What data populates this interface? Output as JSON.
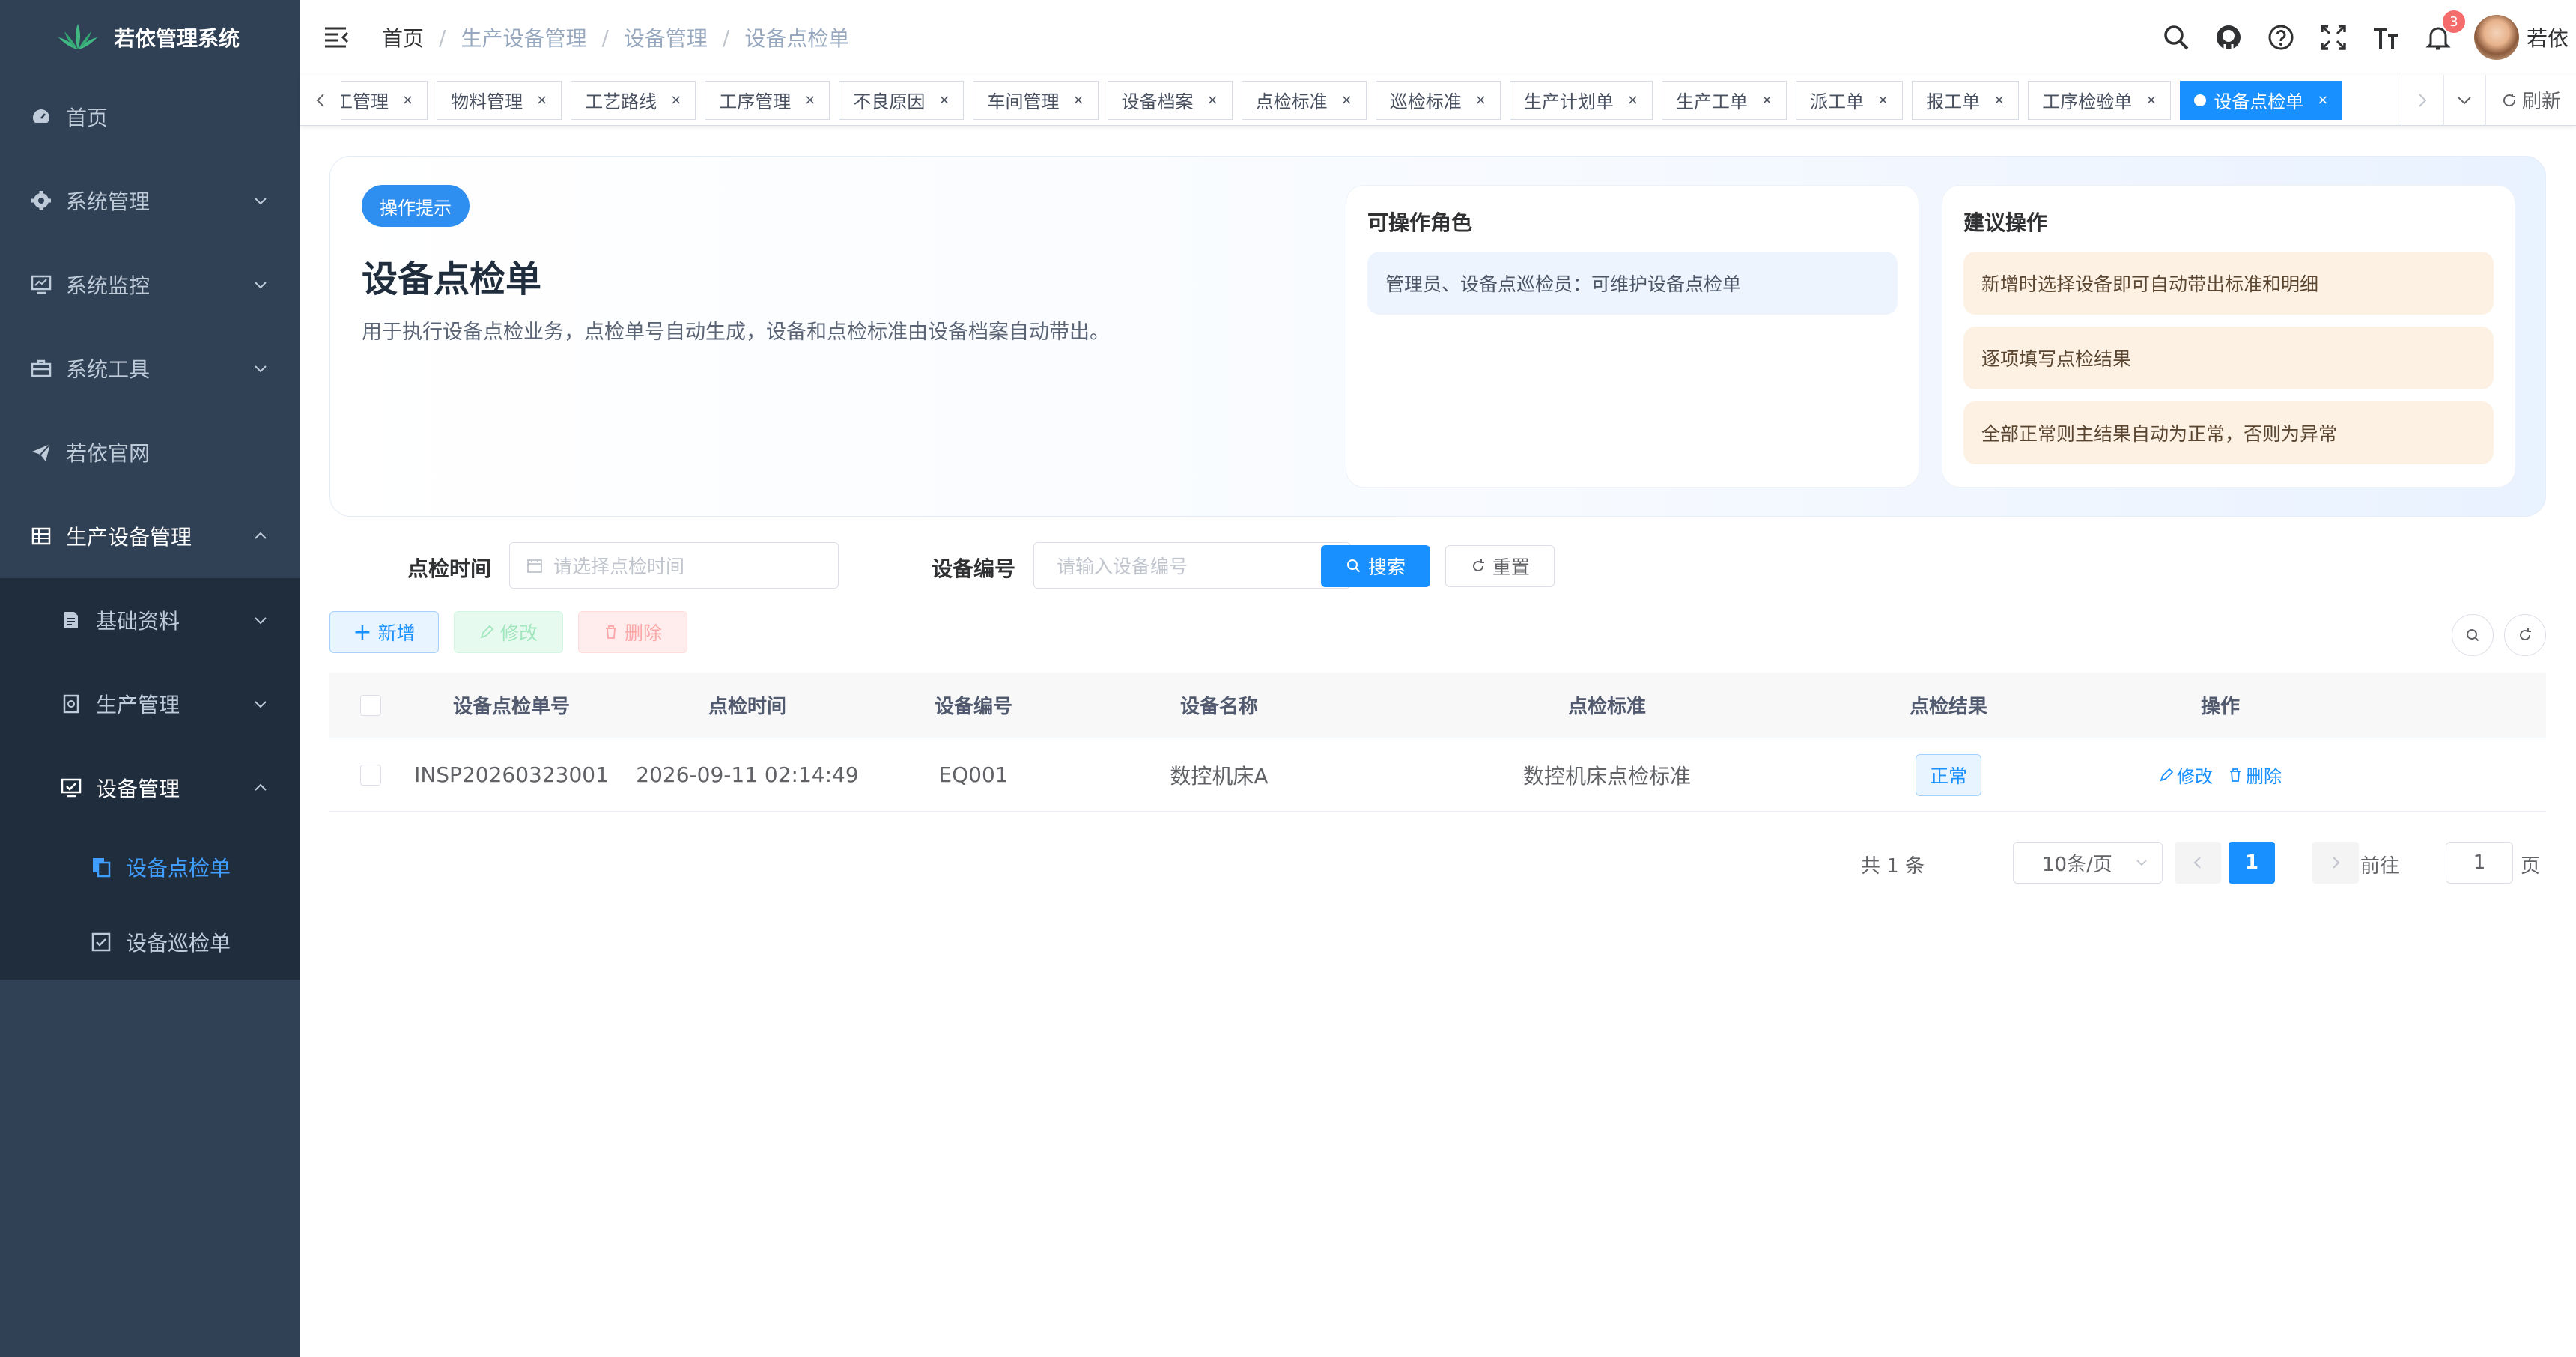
{
  "app": {
    "title": "若依管理系统"
  },
  "sidebar": {
    "items": [
      {
        "label": "首页"
      },
      {
        "label": "系统管理"
      },
      {
        "label": "系统监控"
      },
      {
        "label": "系统工具"
      },
      {
        "label": "若依官网"
      },
      {
        "label": "生产设备管理"
      }
    ],
    "sub": [
      {
        "label": "基础资料"
      },
      {
        "label": "生产管理"
      },
      {
        "label": "设备管理"
      }
    ],
    "sub2": [
      {
        "label": "设备点检单"
      },
      {
        "label": "设备巡检单"
      }
    ]
  },
  "breadcrumb": [
    "首页",
    "生产设备管理",
    "设备管理",
    "设备点检单"
  ],
  "header": {
    "notification_count": "3",
    "username": "若依"
  },
  "tags": [
    {
      "label": "员工管理"
    },
    {
      "label": "物料管理"
    },
    {
      "label": "工艺路线"
    },
    {
      "label": "工序管理"
    },
    {
      "label": "不良原因"
    },
    {
      "label": "车间管理"
    },
    {
      "label": "设备档案"
    },
    {
      "label": "点检标准"
    },
    {
      "label": "巡检标准"
    },
    {
      "label": "生产计划单"
    },
    {
      "label": "生产工单"
    },
    {
      "label": "派工单"
    },
    {
      "label": "报工单"
    },
    {
      "label": "工序检验单"
    },
    {
      "label": "设备点检单"
    }
  ],
  "tags_refresh": "刷新",
  "hero": {
    "pill": "操作提示",
    "title": "设备点检单",
    "desc": "用于执行设备点检业务，点检单号自动生成，设备和点检标准由设备档案自动带出。",
    "roles_title": "可操作角色",
    "roles": [
      "管理员、设备点巡检员：可维护设备点检单"
    ],
    "ops_title": "建议操作",
    "ops": [
      "新增时选择设备即可自动带出标准和明细",
      "逐项填写点检结果",
      "全部正常则主结果自动为正常，否则为异常"
    ]
  },
  "search": {
    "time_label": "点检时间",
    "time_placeholder": "请选择点检时间",
    "code_label": "设备编号",
    "code_placeholder": "请输入设备编号",
    "search_btn": "搜索",
    "reset_btn": "重置"
  },
  "toolbar": {
    "add": "新增",
    "edit": "修改",
    "delete": "删除"
  },
  "table": {
    "headers": [
      "设备点检单号",
      "点检时间",
      "设备编号",
      "设备名称",
      "点检标准",
      "点检结果",
      "操作"
    ],
    "rows": [
      {
        "no": "INSP20260323001",
        "time": "2026-09-11 02:14:49",
        "code": "EQ001",
        "name": "数控机床A",
        "standard": "数控机床点检标准",
        "result": "正常",
        "edit": "修改",
        "delete": "删除"
      }
    ]
  },
  "pagination": {
    "total": "共 1 条",
    "size": "10条/页",
    "current": "1",
    "goto": "前往",
    "jump_value": "1",
    "page_suffix": "页"
  },
  "colors": {
    "sidebar_bg": "#304156",
    "primary": "#1890ff",
    "active_menu": "#409eff"
  }
}
